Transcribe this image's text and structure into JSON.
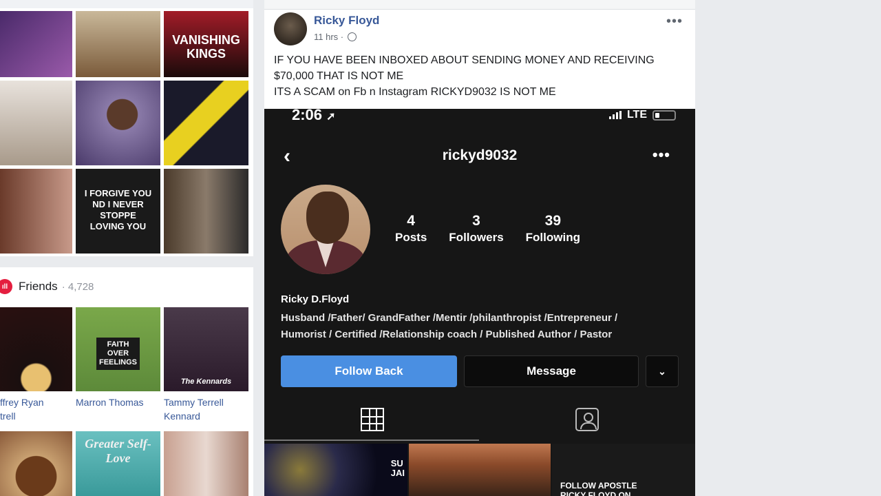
{
  "left_photos": {
    "tiles": [
      {
        "name": "photo-couple-event",
        "text": "",
        "bg": "#6a3d7a"
      },
      {
        "name": "photo-speaker",
        "text": "",
        "bg": "#9a7a5a"
      },
      {
        "name": "photo-vanishing-kings",
        "text": "VANISHING KINGS",
        "bg": "#7a1620"
      },
      {
        "name": "photo-graduation-flyer",
        "text": "",
        "bg": "#d8d2cc"
      },
      {
        "name": "photo-family-selfie",
        "text": "",
        "bg": "#7a6a90"
      },
      {
        "name": "photo-apostle-flyer",
        "text": "",
        "bg": "#1a1a2a"
      },
      {
        "name": "photo-couple-smiling",
        "text": "",
        "bg": "#c49a8a"
      },
      {
        "name": "photo-forgive-quote",
        "text": "I FORGIVE YOU\nND I NEVER STOPPE\nLOVING YOU",
        "bg": "#1a1a1a"
      },
      {
        "name": "photo-handshake",
        "text": "",
        "bg": "#5a4a3a"
      }
    ]
  },
  "friends": {
    "label": "Friends",
    "count": "· 4,728",
    "icon_label": "ıll",
    "people": [
      {
        "name_line1": "ffrey Ryan",
        "name_line2": "trell",
        "bg": "#1a0f0f"
      },
      {
        "name_line1": "Marron Thomas",
        "name_line2": "",
        "bg": "#5d8a3a"
      },
      {
        "name_line1": "Tammy Terrell",
        "name_line2": "Kennard",
        "bg": "#3a2a3a"
      },
      {
        "name_line1": "",
        "name_line2": "",
        "bg": "#8a5a3a"
      },
      {
        "name_line1": "",
        "name_line2": "",
        "bg": "#4ab0b0"
      },
      {
        "name_line1": "",
        "name_line2": "",
        "bg": "#b89a8a"
      }
    ],
    "tile_text": {
      "faith_shirt": "FAITH OVER FEELINGS",
      "kennards": "The Kennards",
      "greater": "Greater Self-Love"
    }
  },
  "post": {
    "author": "Ricky Floyd",
    "time": "11 hrs ·",
    "more": "•••",
    "text_line1": "IF YOU HAVE BEEN INBOXED ABOUT SENDING MONEY AND RECEIVING",
    "text_line2": "$70,000 THAT IS NOT ME",
    "text_line3": "ITS A SCAM on Fb n Instagram RICKYD9032 IS NOT ME"
  },
  "instagram": {
    "status_time": "2:06",
    "status_arrow": "➚",
    "network": "LTE",
    "back": "‹",
    "username": "rickyd9032",
    "more": "•••",
    "stats": [
      {
        "num": "4",
        "label": "Posts"
      },
      {
        "num": "3",
        "label": "Followers"
      },
      {
        "num": "39",
        "label": "Following"
      }
    ],
    "display_name": "Ricky D.Floyd",
    "bio_line1": "Husband /Father/ GrandFather /Mentir /philanthropist /Entrepreneur /",
    "bio_line2": "Humorist / Certified /Relationship coach / Published Author / Pastor",
    "follow_back": "Follow Back",
    "message": "Message",
    "dropdown": "⌄",
    "thumb_texts": {
      "t2": "SU\nJAI",
      "t4": "FOLLOW APOSTLE\nRICKY FLOYD ON"
    },
    "colors": {
      "follow": "#4a8fe2",
      "bg": "#161616"
    }
  }
}
